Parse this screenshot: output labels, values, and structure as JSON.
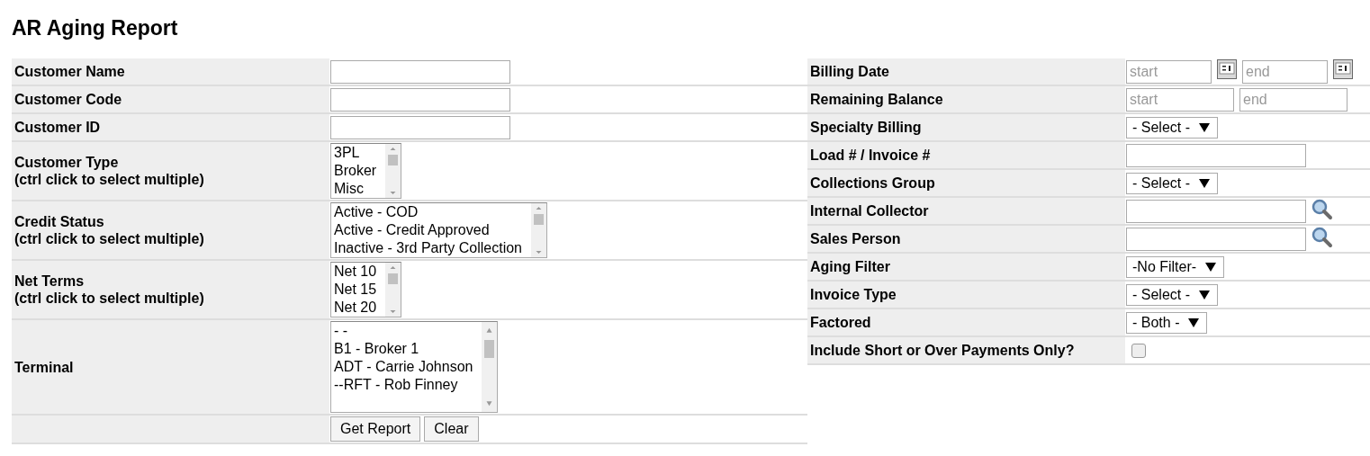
{
  "title": "AR Aging Report",
  "left_rows": [
    {
      "kind": "text",
      "label": "Customer Name"
    },
    {
      "kind": "text",
      "label": "Customer Code"
    },
    {
      "kind": "text",
      "label": "Customer ID"
    },
    {
      "kind": "listbox",
      "label": "Customer Type",
      "hint": "(ctrl click to select multiple)",
      "options": [
        "3PL",
        "Broker",
        "Misc"
      ]
    },
    {
      "kind": "listbox",
      "label": "Credit Status",
      "hint": "(ctrl click to select multiple)",
      "options": [
        "Active - COD",
        "Active - Credit Approved",
        "Inactive - 3rd Party Collection"
      ]
    },
    {
      "kind": "listbox",
      "label": "Net Terms",
      "hint": "(ctrl click to select multiple)",
      "options": [
        "Net 10",
        "Net 15",
        "Net 20"
      ]
    },
    {
      "kind": "listbox",
      "label": "Terminal",
      "options": [
        "- -",
        "B1 - Broker 1",
        "ADT - Carrie Johnson",
        "--RFT - Rob Finney"
      ]
    }
  ],
  "buttons": [
    "Get Report",
    "Clear"
  ],
  "right_rows": [
    {
      "kind": "daterange",
      "label": "Billing Date",
      "start_placeholder": "start",
      "end_placeholder": "end"
    },
    {
      "kind": "range",
      "label": "Remaining Balance",
      "start_placeholder": "start",
      "end_placeholder": "end"
    },
    {
      "kind": "select",
      "label": "Specialty Billing",
      "value": "- Select -"
    },
    {
      "kind": "text",
      "label": "Load # / Invoice #"
    },
    {
      "kind": "select",
      "label": "Collections Group",
      "value": "- Select -"
    },
    {
      "kind": "lookup",
      "label": "Internal Collector"
    },
    {
      "kind": "lookup",
      "label": "Sales Person"
    },
    {
      "kind": "select",
      "label": "Aging Filter",
      "value": "-No Filter-"
    },
    {
      "kind": "select",
      "label": "Invoice Type",
      "value": "- Select -"
    },
    {
      "kind": "select",
      "label": "Factored",
      "value": "- Both -"
    },
    {
      "kind": "checkbox",
      "label": "Include Short or Over Payments Only?",
      "checked": false
    }
  ]
}
